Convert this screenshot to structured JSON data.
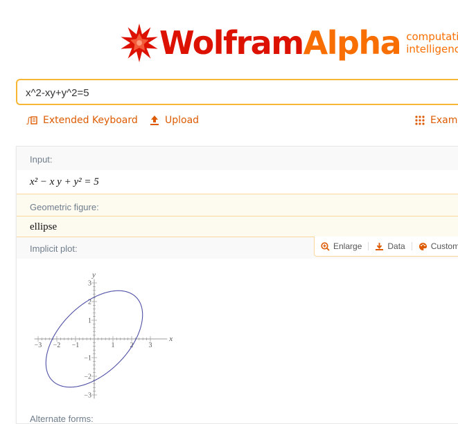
{
  "brand": {
    "name_part1": "Wolfram",
    "name_part2": "Alpha",
    "tagline_line1": "computational",
    "tagline_line2": "intelligence.",
    "colors": {
      "red": "#dd1100",
      "orange": "#f96e00"
    }
  },
  "search": {
    "query": "x^2-xy+y^2=5"
  },
  "toolbar": {
    "extended_keyboard_label": "Extended Keyboard",
    "upload_label": "Upload",
    "examples_label": "Examples"
  },
  "pods": {
    "input": {
      "label": "Input:",
      "equation": "x² − x y + y² = 5"
    },
    "geometric_figure": {
      "label": "Geometric figure:",
      "value": "ellipse"
    },
    "implicit_plot": {
      "label": "Implicit plot:",
      "buttons": {
        "enlarge": "Enlarge",
        "data": "Data",
        "customize": "Customize"
      }
    },
    "alternate_forms": {
      "label": "Alternate forms:"
    }
  },
  "chart_data": {
    "type": "line",
    "equation": "x^2 - x y + y^2 = 5",
    "xlabel": "x",
    "ylabel": "y",
    "xlim": [
      -3.2,
      3.9
    ],
    "ylim": [
      -3.2,
      3.2
    ],
    "x_ticks": [
      -3,
      -2,
      -1,
      1,
      2,
      3
    ],
    "y_ticks": [
      -3,
      -2,
      -1,
      1,
      2,
      3
    ],
    "x_tick_labels": [
      "−3",
      "−2",
      "−1",
      "1",
      "2",
      "3"
    ],
    "y_tick_labels": [
      "−3",
      "−2",
      "−1",
      "1",
      "2",
      "3"
    ],
    "curve_color": "#4f4fa6"
  }
}
